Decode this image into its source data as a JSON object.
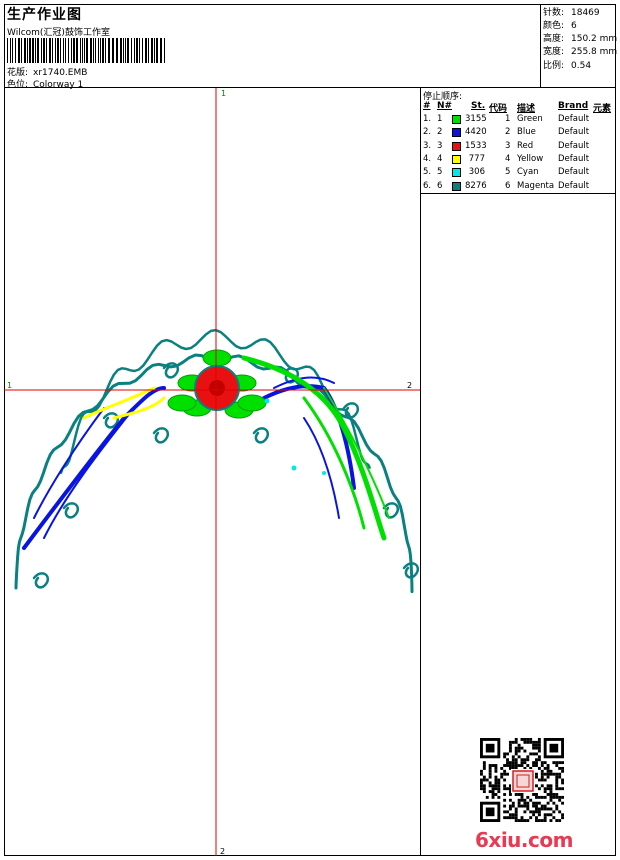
{
  "header": {
    "title": "生产作业图",
    "studio": "Wilcom(汇冠)鼓饰工作室",
    "pattern_label": "花版:",
    "pattern_value": "xr1740.EMB",
    "colorway_label": "色位:",
    "colorway_value": "Colorway 1"
  },
  "stats": {
    "stitches_label": "针数:",
    "stitches_value": "18469",
    "colors_label": "颜色:",
    "colors_value": "6",
    "height_label": "高度:",
    "height_value": "150.2 mm",
    "width_label": "宽度:",
    "width_value": "255.8 mm",
    "scale_label": "比例:",
    "scale_value": "0.54"
  },
  "stop_sequence": {
    "title": "停止顺序:",
    "headers": {
      "idx": "#",
      "n": "N#",
      "st": "St.",
      "code": "代码",
      "desc": "描述",
      "brand": "Brand",
      "element": "元素"
    },
    "rows": [
      {
        "idx": "1.",
        "n": "1",
        "color": "#00e000",
        "st": "3155",
        "code": "1",
        "desc": "Green",
        "brand": "Default"
      },
      {
        "idx": "2.",
        "n": "2",
        "color": "#0a14e0",
        "st": "4420",
        "code": "2",
        "desc": "Blue",
        "brand": "Default"
      },
      {
        "idx": "3.",
        "n": "3",
        "color": "#e81010",
        "st": "1533",
        "code": "3",
        "desc": "Red",
        "brand": "Default"
      },
      {
        "idx": "4.",
        "n": "4",
        "color": "#ffff00",
        "st": "777",
        "code": "4",
        "desc": "Yellow",
        "brand": "Default"
      },
      {
        "idx": "5.",
        "n": "5",
        "color": "#00e8e8",
        "st": "306",
        "code": "5",
        "desc": "Cyan",
        "brand": "Default"
      },
      {
        "idx": "6.",
        "n": "6",
        "color": "#0a8080",
        "st": "8276",
        "code": "6",
        "desc": "Magenta",
        "brand": "Default"
      }
    ]
  },
  "design": {
    "axis_markers": {
      "top": "1",
      "bottom": "2",
      "left": "1",
      "right": "2"
    },
    "crosshair_color": "#e00000",
    "colors": {
      "teal": "#0a8080",
      "blue": "#0a14e0",
      "green": "#00e000",
      "red": "#e81010",
      "yellow": "#ffff00",
      "cyan": "#00e8e8"
    }
  },
  "watermark": {
    "logo_text": "6xiu.com",
    "qr_icon": "qr-code-icon"
  }
}
